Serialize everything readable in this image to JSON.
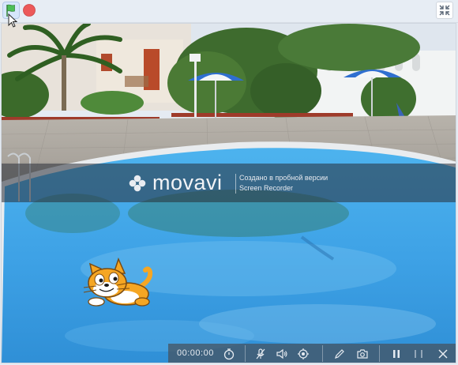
{
  "toolbar": {
    "green_flag_icon": "green-flag-icon",
    "stop_icon": "stop-icon",
    "fullscreen_exit_icon": "fullscreen-exit-icon"
  },
  "stage": {
    "sprite": "scratch-cat",
    "background": "swimming-pool"
  },
  "watermark": {
    "brand": "movavi",
    "line1": "Создано в пробной версии",
    "line2": "Screen Recorder"
  },
  "recorder": {
    "timer": "00:00:00"
  },
  "colors": {
    "flag_green": "#4cbf56",
    "stop_red": "#ec5959",
    "pool_blue": "#3ea2e6",
    "topbar_bg": "#e7edf4"
  }
}
